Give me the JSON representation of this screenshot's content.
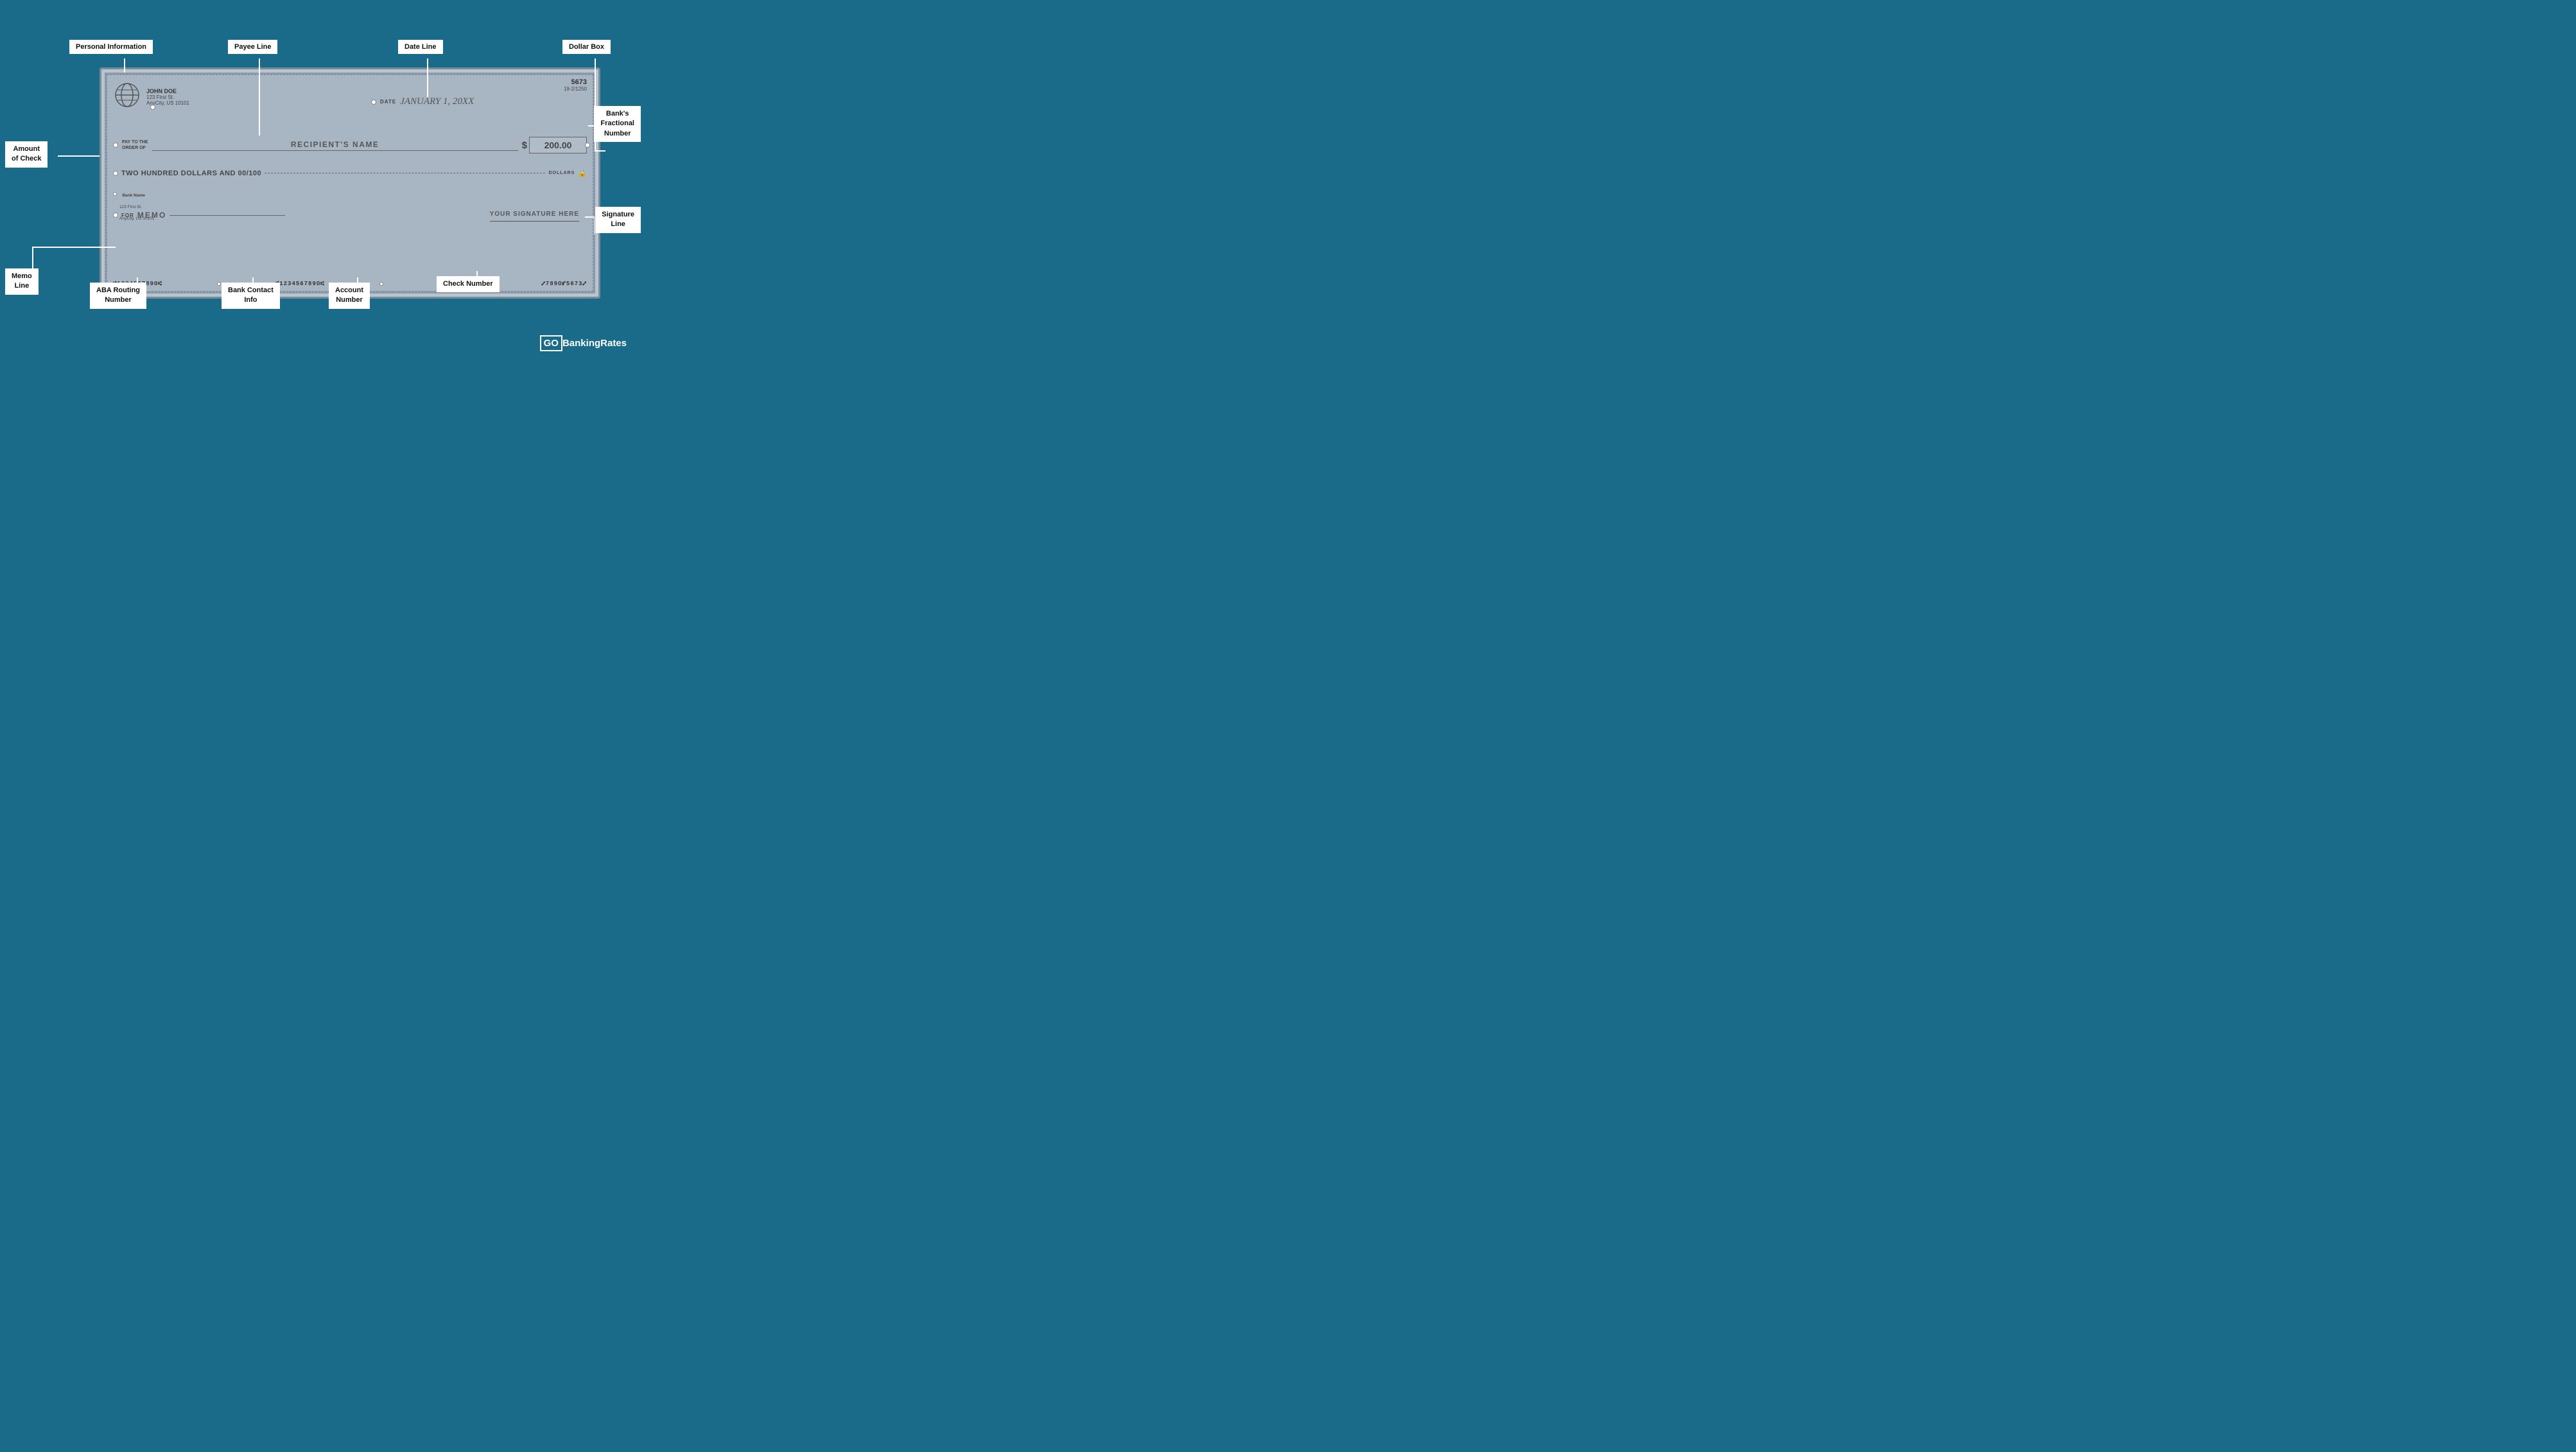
{
  "page": {
    "bg_color": "#1a6a8a"
  },
  "check": {
    "number": "5673",
    "fractional": "19-2/1250",
    "date_label": "DATE",
    "date_value": "JANUARY 1, 20XX",
    "personal_info": {
      "name": "JOHN DOE",
      "address1": "123 First St.",
      "address2": "AnyCity, US 10101"
    },
    "pay_to_label": "PAY TO THE\nORDER OF",
    "recipient": "RECIPIENT'S NAME",
    "dollar_sign": "$",
    "amount_box": "200.00",
    "written_amount": "TWO HUNDRED DOLLARS AND 00/100",
    "dollars_label": "DOLLARS",
    "bank_info": {
      "name": "Bank Name",
      "address1": "123 First St.",
      "address2": "AnyCity, US 10101"
    },
    "for_label": "FOR",
    "memo": "MEMO",
    "signature": "YOUR SIGNATURE HERE",
    "micr": {
      "routing": "⑆123456789O⑆",
      "bank_contact": "⑆123456789O⑆",
      "account": "⑆123456789O⑆",
      "check_num": "⑇789O⑈5673⑇"
    }
  },
  "labels": {
    "personal_information": "Personal Information",
    "payee_line": "Payee Line",
    "date_line": "Date Line",
    "dollar_box": "Dollar Box",
    "banks_fractional_number": "Bank's\nFractional\nNumber",
    "amount_of_check": "Amount\nof Check",
    "signature_line": "Signature\nLine",
    "memo_line": "Memo\nLine",
    "aba_routing_number": "ABA Routing\nNumber",
    "bank_contact_info": "Bank Contact\nInfo",
    "account_number": "Account\nNumber",
    "check_number": "Check Number"
  },
  "logo": {
    "go": "GO",
    "rest": "BankingRates"
  }
}
